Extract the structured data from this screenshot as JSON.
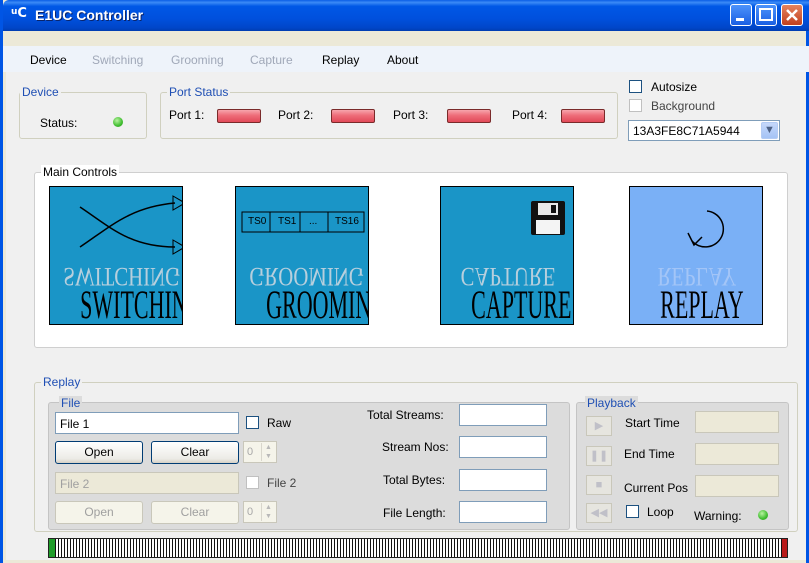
{
  "window": {
    "title": "E1UC Controller",
    "icon_text_small": "u",
    "icon_text_big": "C"
  },
  "menu": {
    "items": [
      {
        "label": "Device",
        "enabled": true
      },
      {
        "label": "Switching",
        "enabled": false
      },
      {
        "label": "Grooming",
        "enabled": false
      },
      {
        "label": "Capture",
        "enabled": false
      },
      {
        "label": "Replay",
        "enabled": true
      },
      {
        "label": "About",
        "enabled": true
      }
    ]
  },
  "device": {
    "legend": "Device",
    "status_label": "Status:",
    "status_color": "#3fbd2f"
  },
  "port_status": {
    "legend": "Port Status",
    "ports": [
      {
        "label": "Port 1:",
        "color": "#e24a59"
      },
      {
        "label": "Port 2:",
        "color": "#e24a59"
      },
      {
        "label": "Port 3:",
        "color": "#e24a59"
      },
      {
        "label": "Port 4:",
        "color": "#e24a59"
      }
    ]
  },
  "options": {
    "autosize_label": "Autosize",
    "autosize_checked": false,
    "background_label": "Background",
    "background_checked": false,
    "serial_selected": "13A3FE8C71A5944"
  },
  "main_controls": {
    "legend": "Main Controls",
    "tiles": [
      {
        "title": "SWITCHING"
      },
      {
        "title": "GROOMING",
        "slots": [
          "TS0",
          "TS1",
          "...",
          "TS16"
        ]
      },
      {
        "title": "CAPTURE"
      },
      {
        "title": "REPLAY"
      }
    ]
  },
  "replay": {
    "legend": "Replay",
    "file": {
      "legend": "File",
      "file1_value": "File 1",
      "raw_label": "Raw",
      "open1_label": "Open",
      "clear1_label": "Clear",
      "spin1_value": "0",
      "file2_placeholder": "File 2",
      "file2_label": "File 2",
      "open2_label": "Open",
      "clear2_label": "Clear",
      "spin2_value": "0"
    },
    "stats": {
      "total_streams_label": "Total Streams:",
      "stream_nos_label": "Stream Nos:",
      "total_bytes_label": "Total Bytes:",
      "file_length_label": "File Length:"
    },
    "playback": {
      "legend": "Playback",
      "start_time_label": "Start Time",
      "end_time_label": "End Time",
      "current_pos_label": "Current Pos",
      "loop_label": "Loop",
      "warning_label": "Warning:",
      "warning_color": "#3fbd2f"
    }
  }
}
